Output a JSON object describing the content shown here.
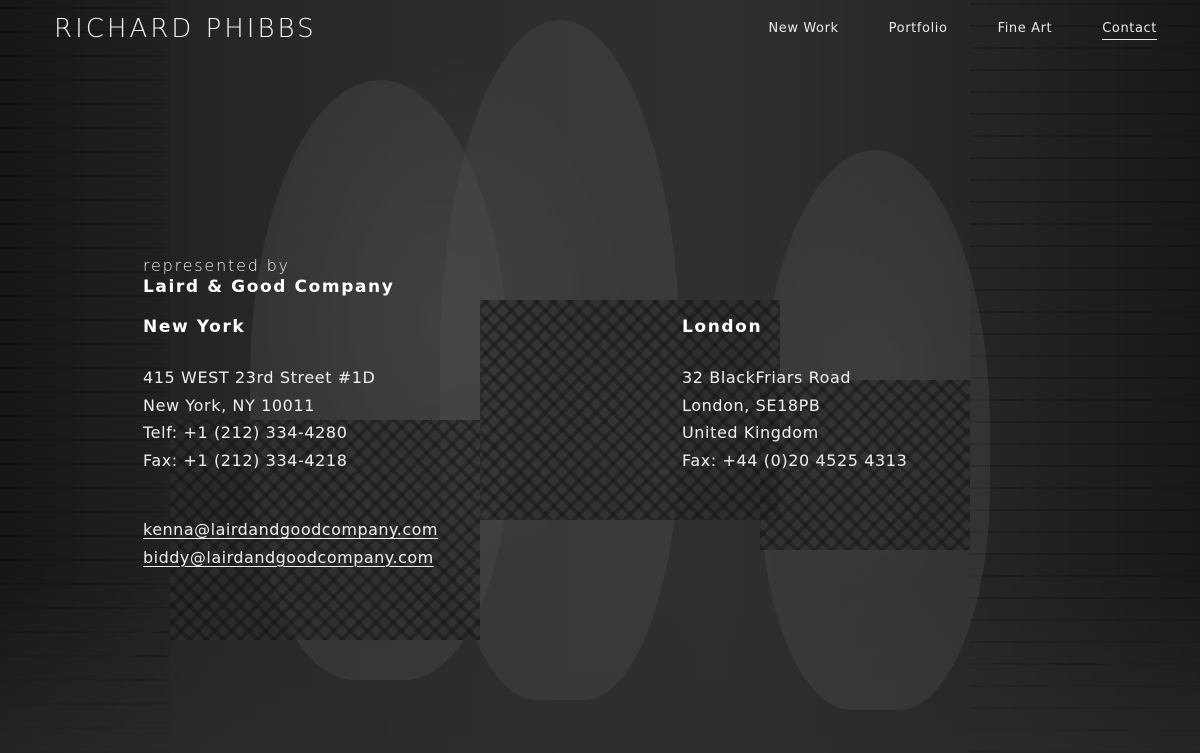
{
  "header": {
    "site_title": "RICHARD PHIBBS",
    "nav": [
      {
        "label": "New Work",
        "active": false
      },
      {
        "label": "Portfolio",
        "active": false
      },
      {
        "label": "Fine Art",
        "active": false
      },
      {
        "label": "Contact",
        "active": true
      }
    ]
  },
  "contact": {
    "represented_by": "represented by",
    "agency": "Laird & Good Company",
    "offices": [
      {
        "city": "New York",
        "lines": [
          "415 WEST 23rd Street #1D",
          "New York, NY 10011",
          "Telf: +1 (212) 334-4280",
          "Fax: +1 (212) 334-4218"
        ]
      },
      {
        "city": "London",
        "lines": [
          "32 BlackFriars Road",
          "London, SE18PB",
          "United Kingdom",
          "Fax: +44 (0)20 4525 4313"
        ]
      }
    ],
    "emails": [
      "kenna@lairdandgoodcompany.com",
      "biddy@lairdandgoodcompany.com"
    ]
  },
  "colors": {
    "text": "#f2f2f2",
    "background": "#2b2b2b"
  }
}
